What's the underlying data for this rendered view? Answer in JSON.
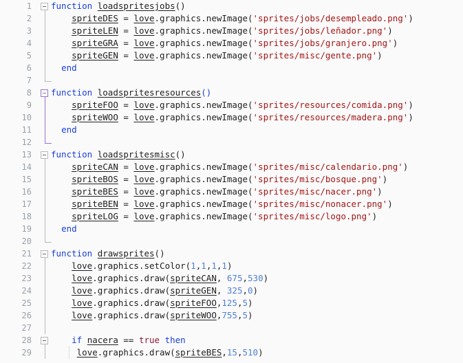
{
  "editor": {
    "app": "code-editor",
    "language": "lua",
    "background": "#fafafa",
    "gutter_color": "#9aa0a6",
    "colors": {
      "keyword": "#1a3fd4",
      "identifier": "#1f1f1f",
      "string": "#a31515",
      "number": "#4f7fd6",
      "boolean": "#8b1a3a",
      "fold_accent": "#9b72d0",
      "fold_default": "#b9b9bd"
    }
  },
  "lines": [
    {
      "number": "1",
      "fold": "open",
      "fold_accent": false,
      "indent_guides": [],
      "tokens": [
        {
          "t": "function",
          "c": "kw"
        },
        {
          "t": " ",
          "c": "plain"
        },
        {
          "t": "loadspritesjobs",
          "c": "ident"
        },
        {
          "t": "()",
          "c": "plain"
        }
      ]
    },
    {
      "number": "2",
      "fold": "line",
      "fold_accent": false,
      "indent_guides": [],
      "tokens": [
        {
          "t": "    ",
          "c": "plain"
        },
        {
          "t": "spriteDES",
          "c": "ident"
        },
        {
          "t": " = ",
          "c": "plain"
        },
        {
          "t": "love",
          "c": "ident"
        },
        {
          "t": ".graphics.newImage(",
          "c": "plain"
        },
        {
          "t": "'sprites/jobs/desempleado.png'",
          "c": "str"
        },
        {
          "t": ")",
          "c": "plain"
        }
      ]
    },
    {
      "number": "3",
      "fold": "line",
      "fold_accent": false,
      "indent_guides": [],
      "tokens": [
        {
          "t": "    ",
          "c": "plain"
        },
        {
          "t": "spriteLEN",
          "c": "ident"
        },
        {
          "t": " = ",
          "c": "plain"
        },
        {
          "t": "love",
          "c": "ident"
        },
        {
          "t": ".graphics.newImage(",
          "c": "plain"
        },
        {
          "t": "'sprites/jobs/leñador.png'",
          "c": "str"
        },
        {
          "t": ")",
          "c": "plain"
        }
      ]
    },
    {
      "number": "4",
      "fold": "line",
      "fold_accent": false,
      "indent_guides": [],
      "tokens": [
        {
          "t": "    ",
          "c": "plain"
        },
        {
          "t": "spriteGRA",
          "c": "ident"
        },
        {
          "t": " = ",
          "c": "plain"
        },
        {
          "t": "love",
          "c": "ident"
        },
        {
          "t": ".graphics.newImage(",
          "c": "plain"
        },
        {
          "t": "'sprites/jobs/granjero.png'",
          "c": "str"
        },
        {
          "t": ")",
          "c": "plain"
        }
      ]
    },
    {
      "number": "5",
      "fold": "line",
      "fold_accent": false,
      "indent_guides": [],
      "tokens": [
        {
          "t": "    ",
          "c": "plain"
        },
        {
          "t": "spriteGEN",
          "c": "ident"
        },
        {
          "t": " = ",
          "c": "plain"
        },
        {
          "t": "love",
          "c": "ident"
        },
        {
          "t": ".graphics.newImage(",
          "c": "plain"
        },
        {
          "t": "'sprites/misc/gente.png'",
          "c": "str"
        },
        {
          "t": ")",
          "c": "plain"
        }
      ]
    },
    {
      "number": "6",
      "fold": "line",
      "fold_accent": false,
      "indent_guides": [],
      "tokens": [
        {
          "t": "  ",
          "c": "plain"
        },
        {
          "t": "end",
          "c": "kw"
        }
      ]
    },
    {
      "number": "7",
      "fold": "end",
      "fold_accent": false,
      "indent_guides": [],
      "tokens": []
    },
    {
      "number": "8",
      "fold": "open",
      "fold_accent": true,
      "indent_guides": [],
      "tokens": [
        {
          "t": "function",
          "c": "kw"
        },
        {
          "t": " ",
          "c": "plain"
        },
        {
          "t": "loadspritesresources",
          "c": "ident"
        },
        {
          "t": "()",
          "c": "paren"
        }
      ]
    },
    {
      "number": "9",
      "fold": "line",
      "fold_accent": true,
      "indent_guides": [],
      "tokens": [
        {
          "t": "    ",
          "c": "plain"
        },
        {
          "t": "spriteFOO",
          "c": "ident"
        },
        {
          "t": " = ",
          "c": "plain"
        },
        {
          "t": "love",
          "c": "ident"
        },
        {
          "t": ".graphics.newImage(",
          "c": "plain"
        },
        {
          "t": "'sprites/resources/comida.png'",
          "c": "str"
        },
        {
          "t": ")",
          "c": "plain"
        }
      ]
    },
    {
      "number": "10",
      "fold": "line",
      "fold_accent": true,
      "indent_guides": [],
      "tokens": [
        {
          "t": "    ",
          "c": "plain"
        },
        {
          "t": "spriteWOO",
          "c": "ident"
        },
        {
          "t": " = ",
          "c": "plain"
        },
        {
          "t": "love",
          "c": "ident"
        },
        {
          "t": ".graphics.newImage(",
          "c": "plain"
        },
        {
          "t": "'sprites/resources/madera.png'",
          "c": "str"
        },
        {
          "t": ")",
          "c": "plain"
        }
      ]
    },
    {
      "number": "11",
      "fold": "line",
      "fold_accent": true,
      "indent_guides": [],
      "tokens": [
        {
          "t": "  ",
          "c": "plain"
        },
        {
          "t": "end",
          "c": "kw"
        }
      ]
    },
    {
      "number": "12",
      "fold": "end",
      "fold_accent": true,
      "indent_guides": [],
      "tokens": []
    },
    {
      "number": "13",
      "fold": "open",
      "fold_accent": false,
      "indent_guides": [],
      "tokens": [
        {
          "t": "function",
          "c": "kw"
        },
        {
          "t": " ",
          "c": "plain"
        },
        {
          "t": "loadspritesmisc",
          "c": "ident"
        },
        {
          "t": "()",
          "c": "plain"
        }
      ]
    },
    {
      "number": "14",
      "fold": "line",
      "fold_accent": false,
      "indent_guides": [],
      "tokens": [
        {
          "t": "    ",
          "c": "plain"
        },
        {
          "t": "spriteCAN",
          "c": "ident"
        },
        {
          "t": " = ",
          "c": "plain"
        },
        {
          "t": "love",
          "c": "ident"
        },
        {
          "t": ".graphics.newImage(",
          "c": "plain"
        },
        {
          "t": "'sprites/misc/calendario.png'",
          "c": "str"
        },
        {
          "t": ")",
          "c": "plain"
        }
      ]
    },
    {
      "number": "15",
      "fold": "line",
      "fold_accent": false,
      "indent_guides": [],
      "tokens": [
        {
          "t": "    ",
          "c": "plain"
        },
        {
          "t": "spriteBOS",
          "c": "ident"
        },
        {
          "t": " = ",
          "c": "plain"
        },
        {
          "t": "love",
          "c": "ident"
        },
        {
          "t": ".graphics.newImage(",
          "c": "plain"
        },
        {
          "t": "'sprites/misc/bosque.png'",
          "c": "str"
        },
        {
          "t": ")",
          "c": "plain"
        }
      ]
    },
    {
      "number": "16",
      "fold": "line",
      "fold_accent": false,
      "indent_guides": [],
      "tokens": [
        {
          "t": "    ",
          "c": "plain"
        },
        {
          "t": "spriteBES",
          "c": "ident"
        },
        {
          "t": " = ",
          "c": "plain"
        },
        {
          "t": "love",
          "c": "ident"
        },
        {
          "t": ".graphics.newImage(",
          "c": "plain"
        },
        {
          "t": "'sprites/misc/nacer.png'",
          "c": "str"
        },
        {
          "t": ")",
          "c": "plain"
        }
      ]
    },
    {
      "number": "17",
      "fold": "line",
      "fold_accent": false,
      "indent_guides": [],
      "tokens": [
        {
          "t": "    ",
          "c": "plain"
        },
        {
          "t": "spriteBEN",
          "c": "ident"
        },
        {
          "t": " = ",
          "c": "plain"
        },
        {
          "t": "love",
          "c": "ident"
        },
        {
          "t": ".graphics.newImage(",
          "c": "plain"
        },
        {
          "t": "'sprites/misc/nonacer.png'",
          "c": "str"
        },
        {
          "t": ")",
          "c": "plain"
        }
      ]
    },
    {
      "number": "18",
      "fold": "line",
      "fold_accent": false,
      "indent_guides": [],
      "tokens": [
        {
          "t": "    ",
          "c": "plain"
        },
        {
          "t": "spriteLOG",
          "c": "ident"
        },
        {
          "t": " = ",
          "c": "plain"
        },
        {
          "t": "love",
          "c": "ident"
        },
        {
          "t": ".graphics.newImage(",
          "c": "plain"
        },
        {
          "t": "'sprites/misc/logo.png'",
          "c": "str"
        },
        {
          "t": ")",
          "c": "plain"
        }
      ]
    },
    {
      "number": "19",
      "fold": "line",
      "fold_accent": false,
      "indent_guides": [],
      "tokens": [
        {
          "t": "  ",
          "c": "plain"
        },
        {
          "t": "end",
          "c": "kw"
        }
      ]
    },
    {
      "number": "20",
      "fold": "end",
      "fold_accent": false,
      "indent_guides": [],
      "tokens": []
    },
    {
      "number": "21",
      "fold": "open",
      "fold_accent": false,
      "indent_guides": [],
      "tokens": [
        {
          "t": "function",
          "c": "kw"
        },
        {
          "t": " ",
          "c": "plain"
        },
        {
          "t": "drawsprites",
          "c": "ident"
        },
        {
          "t": "()",
          "c": "plain"
        }
      ]
    },
    {
      "number": "22",
      "fold": "line",
      "fold_accent": false,
      "indent_guides": [],
      "tokens": [
        {
          "t": "    ",
          "c": "plain"
        },
        {
          "t": "love",
          "c": "ident"
        },
        {
          "t": ".graphics.setColor(",
          "c": "plain"
        },
        {
          "t": "1",
          "c": "num"
        },
        {
          "t": ",",
          "c": "plain"
        },
        {
          "t": "1",
          "c": "num"
        },
        {
          "t": ",",
          "c": "plain"
        },
        {
          "t": "1",
          "c": "num"
        },
        {
          "t": ",",
          "c": "plain"
        },
        {
          "t": "1",
          "c": "num"
        },
        {
          "t": ")",
          "c": "plain"
        }
      ]
    },
    {
      "number": "23",
      "fold": "line",
      "fold_accent": false,
      "indent_guides": [],
      "tokens": [
        {
          "t": "    ",
          "c": "plain"
        },
        {
          "t": "love",
          "c": "ident"
        },
        {
          "t": ".graphics.draw(",
          "c": "plain"
        },
        {
          "t": "spriteCAN",
          "c": "ident"
        },
        {
          "t": ", ",
          "c": "plain"
        },
        {
          "t": "675",
          "c": "num"
        },
        {
          "t": ",",
          "c": "plain"
        },
        {
          "t": "530",
          "c": "num"
        },
        {
          "t": ")",
          "c": "plain"
        }
      ]
    },
    {
      "number": "24",
      "fold": "line",
      "fold_accent": false,
      "indent_guides": [],
      "tokens": [
        {
          "t": "    ",
          "c": "plain"
        },
        {
          "t": "love",
          "c": "ident"
        },
        {
          "t": ".graphics.draw(",
          "c": "plain"
        },
        {
          "t": "spriteGEN",
          "c": "ident"
        },
        {
          "t": ", ",
          "c": "plain"
        },
        {
          "t": "325",
          "c": "num"
        },
        {
          "t": ",",
          "c": "plain"
        },
        {
          "t": "0",
          "c": "num"
        },
        {
          "t": ")",
          "c": "plain"
        }
      ]
    },
    {
      "number": "25",
      "fold": "line",
      "fold_accent": false,
      "indent_guides": [],
      "tokens": [
        {
          "t": "    ",
          "c": "plain"
        },
        {
          "t": "love",
          "c": "ident"
        },
        {
          "t": ".graphics.draw(",
          "c": "plain"
        },
        {
          "t": "spriteFOO",
          "c": "ident"
        },
        {
          "t": ",",
          "c": "plain"
        },
        {
          "t": "125",
          "c": "num"
        },
        {
          "t": ",",
          "c": "plain"
        },
        {
          "t": "5",
          "c": "num"
        },
        {
          "t": ")",
          "c": "plain"
        }
      ]
    },
    {
      "number": "26",
      "fold": "line",
      "fold_accent": false,
      "indent_guides": [],
      "tokens": [
        {
          "t": "    ",
          "c": "plain"
        },
        {
          "t": "love",
          "c": "ident"
        },
        {
          "t": ".graphics.draw(",
          "c": "plain"
        },
        {
          "t": "spriteWOO",
          "c": "ident"
        },
        {
          "t": ",",
          "c": "plain"
        },
        {
          "t": "755",
          "c": "num"
        },
        {
          "t": ",",
          "c": "plain"
        },
        {
          "t": "5",
          "c": "num"
        },
        {
          "t": ")",
          "c": "plain"
        }
      ]
    },
    {
      "number": "27",
      "fold": "line",
      "fold_accent": false,
      "indent_guides": [],
      "tokens": []
    },
    {
      "number": "28",
      "fold": "open-nested",
      "fold_accent": false,
      "indent_guides": [],
      "tokens": [
        {
          "t": "    ",
          "c": "plain"
        },
        {
          "t": "if",
          "c": "kw"
        },
        {
          "t": " ",
          "c": "plain"
        },
        {
          "t": "nacera",
          "c": "ident"
        },
        {
          "t": " == ",
          "c": "plain"
        },
        {
          "t": "true",
          "c": "bool"
        },
        {
          "t": " ",
          "c": "plain"
        },
        {
          "t": "then",
          "c": "kw"
        }
      ]
    },
    {
      "number": "29",
      "fold": "line",
      "fold_accent": false,
      "indent_guides": [
        100
      ],
      "tokens": [
        {
          "t": "     ",
          "c": "plain"
        },
        {
          "t": "love",
          "c": "ident"
        },
        {
          "t": ".graphics.draw(",
          "c": "plain"
        },
        {
          "t": "spriteBES",
          "c": "ident"
        },
        {
          "t": ",",
          "c": "plain"
        },
        {
          "t": "15",
          "c": "num"
        },
        {
          "t": ",",
          "c": "plain"
        },
        {
          "t": "510",
          "c": "num"
        },
        {
          "t": ")",
          "c": "plain"
        }
      ]
    }
  ]
}
